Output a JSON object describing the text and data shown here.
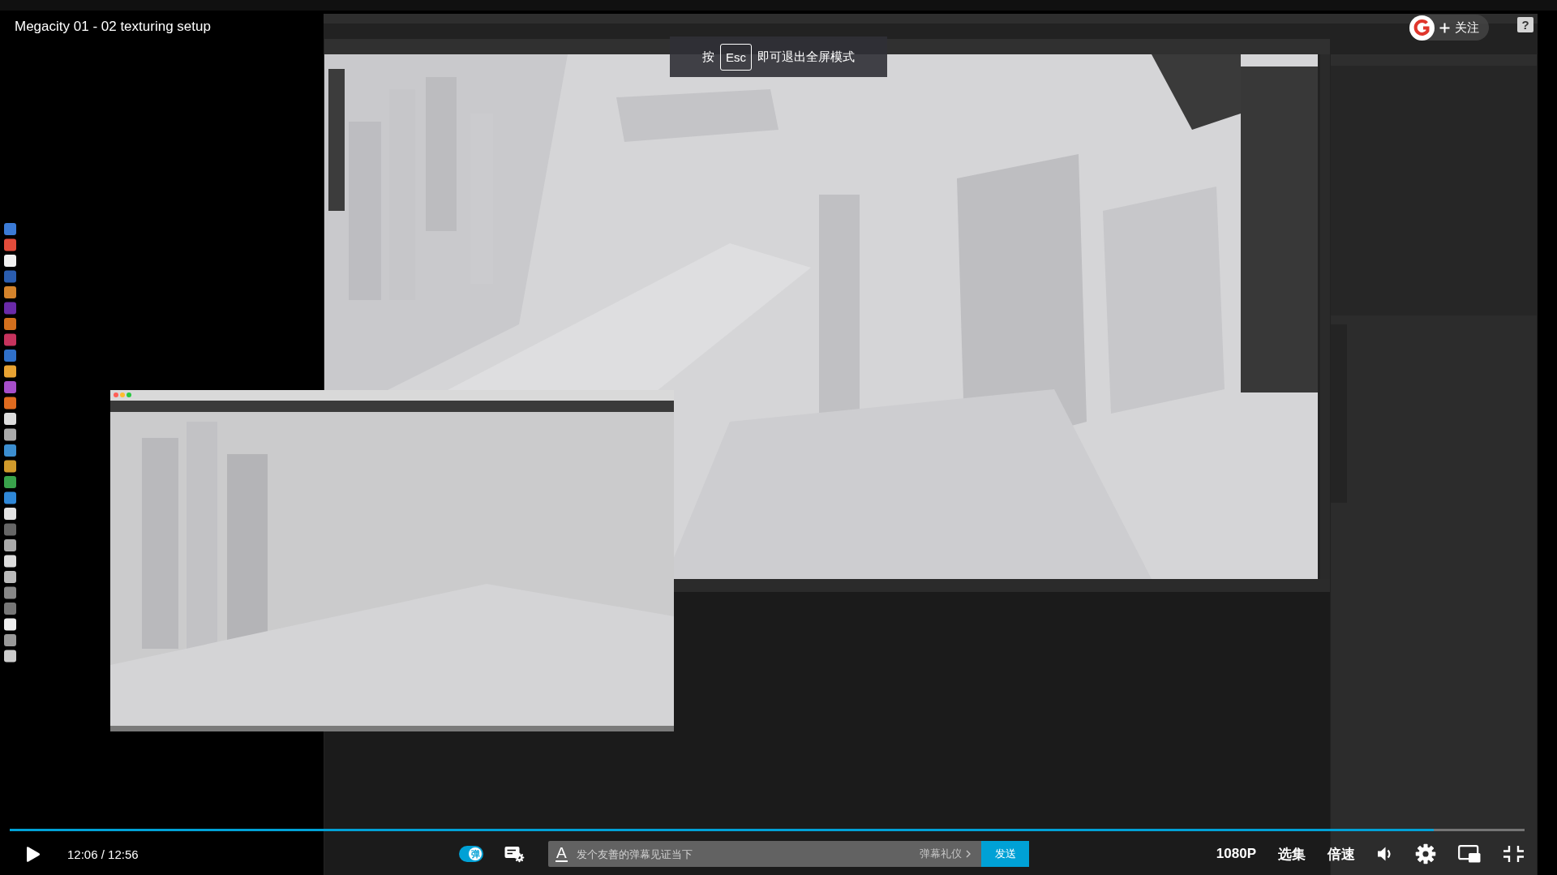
{
  "video_title": "Megacity 01 - 02 texturing setup",
  "fullscreen_notice": {
    "before": "按",
    "key": "Esc",
    "after": "即可退出全屏模式"
  },
  "follow_button": {
    "label": "关注"
  },
  "help_button": {
    "label": "?"
  },
  "progress": {
    "level": 0.94
  },
  "controls": {
    "paused": true,
    "time": "12:06 / 12:56",
    "danmaku_toggle": {
      "label": "弹",
      "on": true
    },
    "danmaku_input": {
      "style_button": "A",
      "placeholder": "发个友善的弹幕见证当下",
      "etiquette_link": "弹幕礼仪",
      "send_button": "发送"
    },
    "quality": "1080P",
    "episodes": "选集",
    "speed": "倍速"
  }
}
